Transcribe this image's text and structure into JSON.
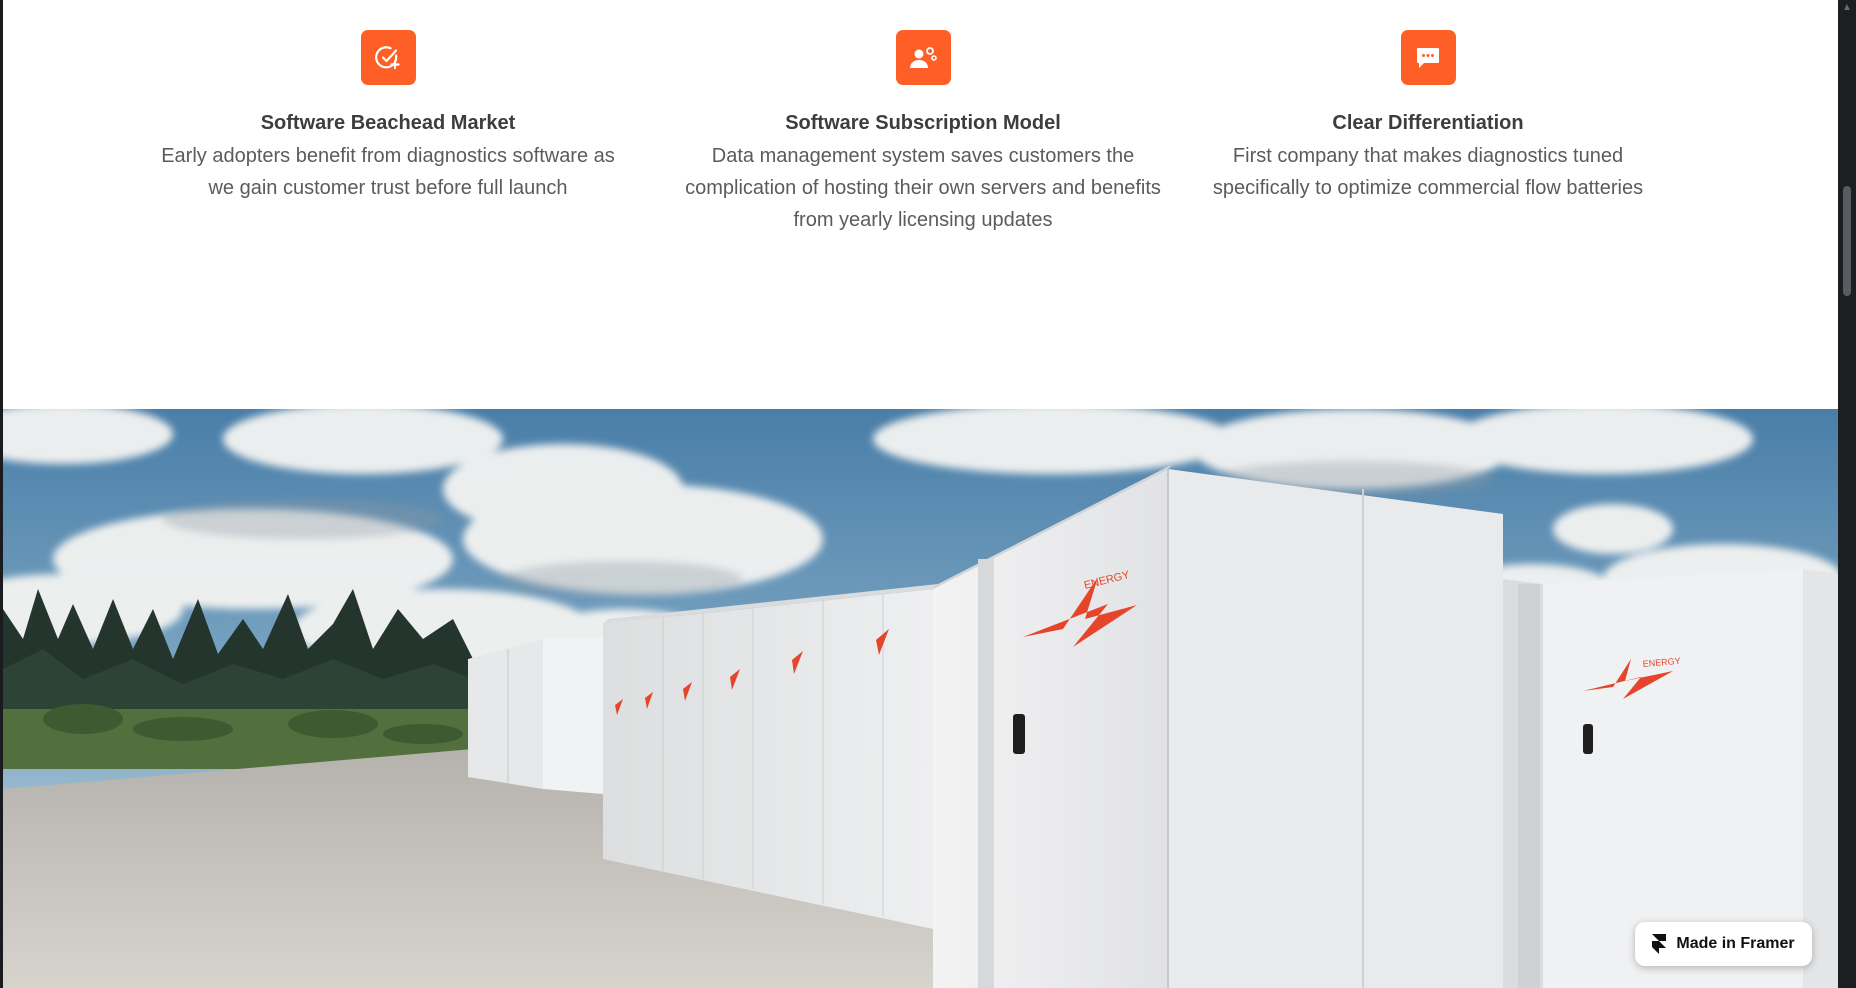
{
  "features": [
    {
      "icon": "check-plus-icon",
      "title": "Software Beachead Market",
      "description": "Early adopters benefit from diagnostics software as we gain customer trust before full launch"
    },
    {
      "icon": "user-gears-icon",
      "title": "Software Subscription Model",
      "description": "Data management system saves customers the complication of hosting their own servers and benefits from yearly licensing updates"
    },
    {
      "icon": "chat-bubble-icon",
      "title": "Clear Differentiation",
      "description": "First company that makes diagnostics tuned specifically to optimize commercial flow batteries"
    }
  ],
  "hero": {
    "container_logo_text": "ENERGY"
  },
  "badge": {
    "label": "Made in Framer"
  },
  "colors": {
    "accent": "#fd5f26",
    "logo_red": "#e4452b"
  }
}
